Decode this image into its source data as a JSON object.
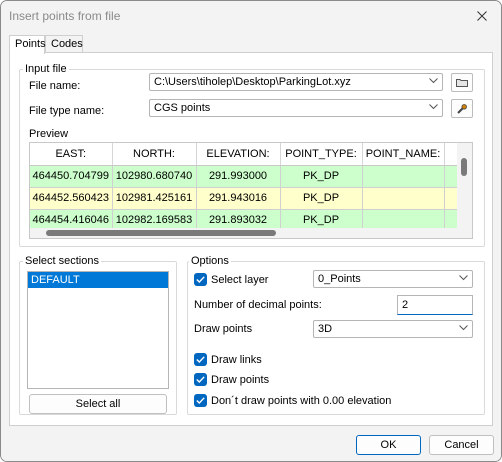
{
  "window": {
    "title": "Insert points from file"
  },
  "tabs": [
    {
      "label": "Points"
    },
    {
      "label": "Codes"
    }
  ],
  "input_file": {
    "group_label": "Input file",
    "file_name_label": "File name:",
    "file_name_value": "C:\\Users\\tiholep\\Desktop\\ParkingLot.xyz",
    "file_type_label": "File type name:",
    "file_type_value": "CGS points",
    "preview_label": "Preview"
  },
  "preview_table": {
    "columns": [
      "EAST:",
      "NORTH:",
      "ELEVATION:",
      "POINT_TYPE:",
      "POINT_NAME:"
    ],
    "rows": [
      [
        "464450.704799",
        "102980.680740",
        "291.993000",
        "PK_DP",
        ""
      ],
      [
        "464452.560423",
        "102981.425161",
        "291.943016",
        "PK_DP",
        ""
      ],
      [
        "464454.416046",
        "102982.169583",
        "291.893032",
        "PK_DP",
        ""
      ]
    ],
    "row_colors": [
      "#ccffcc",
      "#ffffcc",
      "#ccffcc"
    ]
  },
  "select_sections": {
    "label": "Select sections",
    "items": [
      "DEFAULT"
    ],
    "select_all_label": "Select all"
  },
  "options": {
    "label": "Options",
    "select_layer_label": "Select layer",
    "select_layer_value": "0_Points",
    "decimal_label": "Number of decimal points:",
    "decimal_value": "2",
    "draw_points_label": "Draw points",
    "draw_points_value": "3D",
    "draw_links_label": "Draw links",
    "draw_points_check_label": "Draw points",
    "dont_draw_label": "Don´t draw points with 0.00 elevation"
  },
  "footer": {
    "ok_label": "OK",
    "cancel_label": "Cancel"
  },
  "colors": {
    "accent": "#0067c0",
    "selection": "#0078d7"
  }
}
